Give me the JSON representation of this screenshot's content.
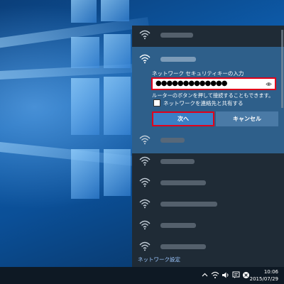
{
  "flyout": {
    "security_key_prompt": "ネットワーク セキュリティキーの入力",
    "password_value": "●●●●●●●●●●●●●",
    "hint_text": "ルーターのボタンを押して接続することもできます。",
    "share_label": "ネットワークを連絡先と共有する",
    "next_label": "次へ",
    "cancel_label": "キャンセル",
    "settings_link": "ネットワーク設定"
  },
  "networks": [
    {
      "name": "",
      "icon": "wifi-icon"
    },
    {
      "name": "",
      "icon": "wifi-icon",
      "expanded": true
    },
    {
      "name": "",
      "icon": "wifi-icon"
    },
    {
      "name": "",
      "icon": "wifi-icon"
    },
    {
      "name": "",
      "icon": "wifi-icon"
    },
    {
      "name": "",
      "icon": "wifi-icon"
    },
    {
      "name": "",
      "icon": "wifi-icon"
    },
    {
      "name": "",
      "icon": "wifi-icon"
    },
    {
      "name": "",
      "icon": "wifi-icon"
    }
  ],
  "taskbar": {
    "time": "10:06",
    "date": "2015/07/29",
    "tray_icons": [
      "chevron-up-icon",
      "network-icon",
      "volume-icon",
      "notification-icon",
      "close-circle-icon"
    ]
  },
  "colors": {
    "accent": "#3a7fc5",
    "highlight_border": "#e0001a",
    "flyout_bg": "#1f2b36",
    "expanded_bg": "#2e5f8a",
    "taskbar_bg": "#0e1924"
  }
}
